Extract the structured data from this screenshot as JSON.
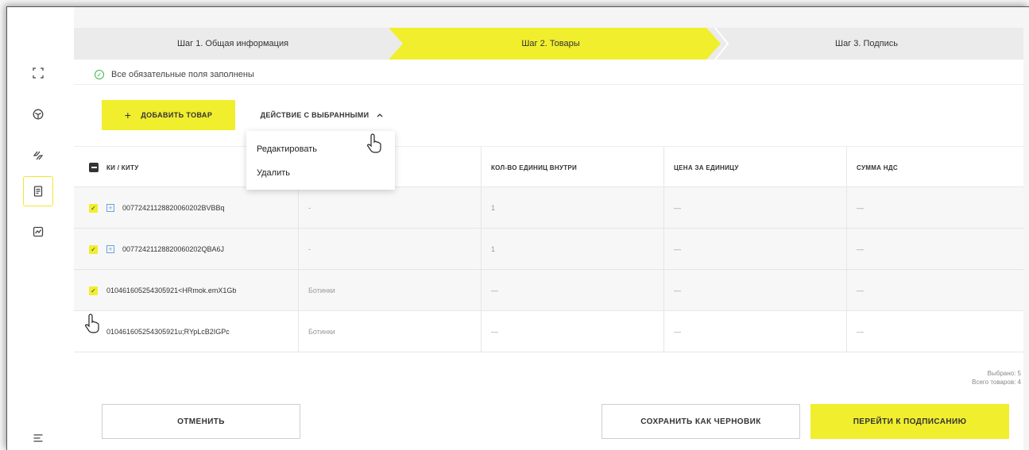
{
  "colors": {
    "accent": "#f1ee2e",
    "success": "#3ab54a",
    "link": "#6aa3d8"
  },
  "sidebar": {
    "items": [
      {
        "icon": "expand-icon"
      },
      {
        "icon": "box-icon"
      },
      {
        "icon": "transfer-icon"
      },
      {
        "icon": "document-icon",
        "active": true
      },
      {
        "icon": "chart-icon"
      },
      {
        "icon": "menu-icon"
      }
    ]
  },
  "steps": [
    {
      "label": "Шаг 1. Общая информация"
    },
    {
      "label": "Шаг 2. Товары",
      "active": true
    },
    {
      "label": "Шаг 3. Подпись"
    }
  ],
  "info": {
    "text": "Все обязательные поля заполнены"
  },
  "toolbar": {
    "add_label": "ДОБАВИТЬ ТОВАР",
    "add_plus": "+",
    "action_label": "ДЕЙСТВИЕ С ВЫБРАННЫМИ",
    "action_chevron": "^"
  },
  "dropdown": {
    "items": [
      "Редактировать",
      "Удалить"
    ]
  },
  "table": {
    "headers": [
      "КИ / КИТУ",
      "",
      "КОЛ-ВО ЕДИНИЦ ВНУТРИ",
      "ЦЕНА ЗА ЕДИНИЦУ",
      "СУММА НДС"
    ],
    "rows": [
      {
        "checked": true,
        "expandable": true,
        "code": "00772421128820060202BVBBq",
        "name": "-",
        "qty": "1",
        "price": "—",
        "vat": "—"
      },
      {
        "checked": true,
        "expandable": true,
        "code": "00772421128820060202QBA6J",
        "name": "-",
        "qty": "1",
        "price": "—",
        "vat": "—"
      },
      {
        "checked": true,
        "expandable": false,
        "code": "010461605254305921<HRmok.emX1Gb",
        "name": "Ботинки",
        "qty": "—",
        "price": "—",
        "vat": "—"
      },
      {
        "checked": false,
        "expandable": false,
        "code": "010461605254305921u;RYpLcB2IGPc",
        "name": "Ботинки",
        "qty": "—",
        "price": "—",
        "vat": "—"
      }
    ]
  },
  "summary": {
    "selected": "Выбрано: 5",
    "total": "Всего товаров: 4"
  },
  "footer": {
    "cancel_label": "ОТМЕНИТЬ",
    "draft_label": "СОХРАНИТЬ КАК ЧЕРНОВИК",
    "sign_label": "ПЕРЕЙТИ К ПОДПИСАНИЮ"
  }
}
